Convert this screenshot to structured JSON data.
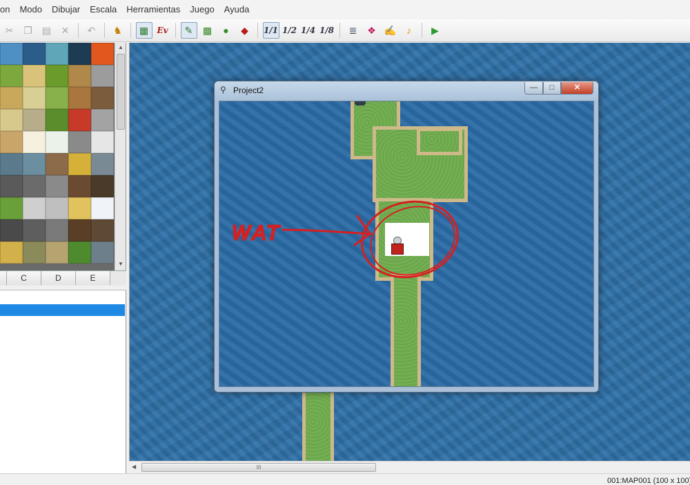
{
  "menu": [
    "on",
    "Modo",
    "Dibujar",
    "Escala",
    "Herramientas",
    "Juego",
    "Ayuda"
  ],
  "toolbar": {
    "icons": [
      "cut-icon",
      "copy-icon",
      "paste-icon",
      "delete-icon",
      "undo-icon",
      "resource-manager-icon",
      "layer-map-icon",
      "event-layer-icon",
      "pencil-icon",
      "rectangle-icon",
      "ellipse-icon",
      "fill-icon",
      "zoom-1-1",
      "zoom-1-2",
      "zoom-1-4",
      "zoom-1-8",
      "database-icon",
      "material-icon",
      "script-editor-icon",
      "sound-test-icon",
      "play-icon"
    ],
    "event_label": "Ev",
    "zoom_labels": [
      "1/1",
      "1/2",
      "1/4",
      "1/8"
    ]
  },
  "palette": {
    "tabs": [
      "",
      "C",
      "D",
      "E"
    ]
  },
  "game_window": {
    "title": "Project2",
    "minimize_symbol": "—",
    "maximize_symbol": "□",
    "close_symbol": "✕",
    "annotation": "WAT"
  },
  "scrollbar": {
    "grip": "III"
  },
  "status": {
    "map_info": "001:MAP001 (100 x 100)"
  }
}
